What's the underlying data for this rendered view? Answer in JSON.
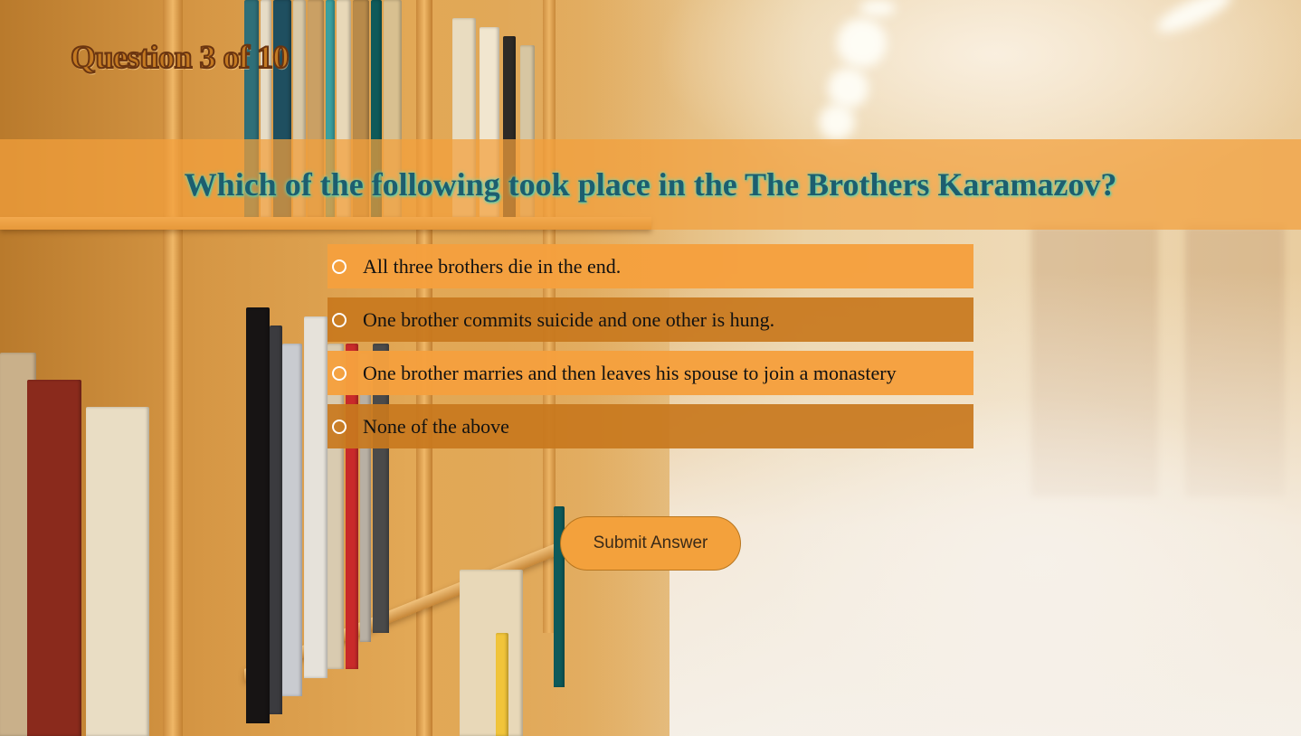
{
  "progress": {
    "label": "Question 3 of 10",
    "current": 3,
    "total": 10
  },
  "question": {
    "text": "Which of the following took place in the The Brothers Karamazov?"
  },
  "options": [
    {
      "label": "All three brothers die in the end.",
      "selected": false
    },
    {
      "label": "One brother commits suicide and one other is hung.",
      "selected": false
    },
    {
      "label": "One brother marries and then leaves his spouse to join a monastery",
      "selected": false
    },
    {
      "label": "None of the above",
      "selected": false
    }
  ],
  "submit": {
    "label": "Submit Answer"
  },
  "colors": {
    "band": "#f3a03c",
    "option_light": "#f5a03e",
    "option_dark": "#c8781e",
    "question_text": "#1d5e6f",
    "counter_text": "#c47a22",
    "button": "#f3a13c"
  },
  "background": {
    "description_icon": "library-bookshelf-background"
  }
}
